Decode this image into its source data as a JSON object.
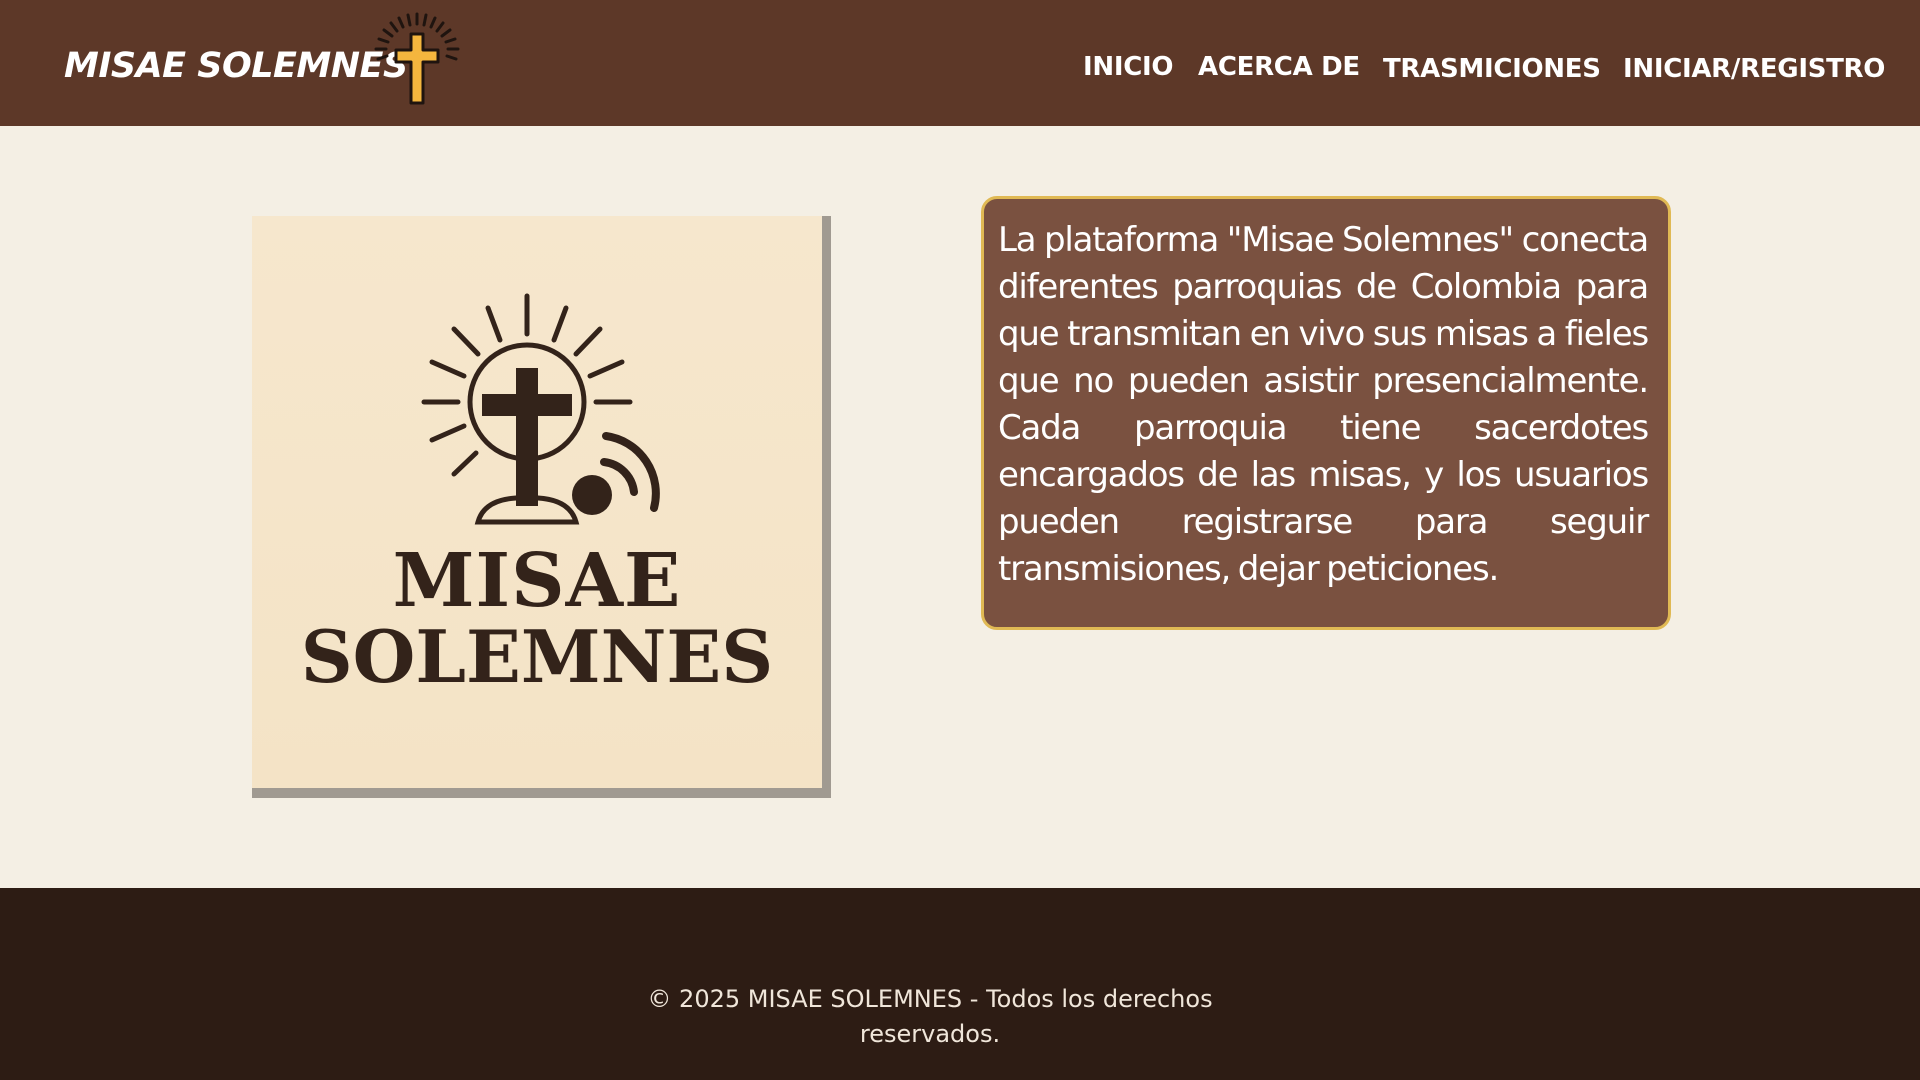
{
  "header": {
    "brand": "MISAE SOLEMNES",
    "brand_icon": "cross-with-rays-icon",
    "background_color": "#5d3828",
    "nav": [
      {
        "label": "INICIO"
      },
      {
        "label": "ACERCA DE"
      },
      {
        "label": "TRASMICIONES"
      },
      {
        "label": "INICIAR/REGISTRO"
      }
    ]
  },
  "main": {
    "logo": {
      "line1": "MISAE",
      "line2": "SOLEMNES",
      "icon": "cross-sun-broadcast-icon"
    },
    "description": "La plataforma \"Misae Solemnes\" conecta diferentes parroquias de Colombia para que transmitan en vivo sus misas a fieles que no pueden asistir presencialmente. Cada parroquia tiene sacerdotes encargados de las misas, y los usuarios pueden registrarse para seguir transmisiones, dejar peticiones.",
    "description_box_color": "#7a5140",
    "description_border_color": "#e0b954"
  },
  "footer": {
    "text": "© 2025 MISAE SOLEMNES - Todos los derechos reservados.",
    "background_color": "#2d1c14"
  }
}
